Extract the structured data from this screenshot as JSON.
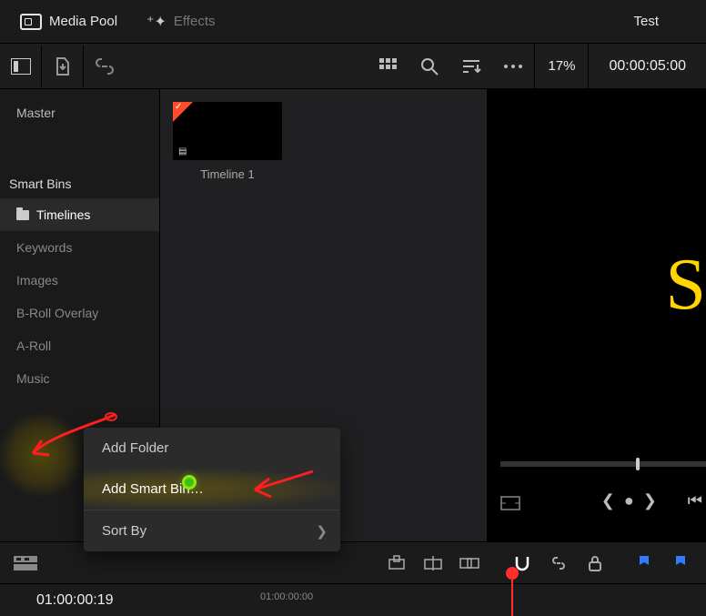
{
  "header": {
    "mediapool_label": "Media Pool",
    "effects_label": "Effects",
    "project_name": "Test"
  },
  "toolbar": {
    "zoom": "17%",
    "timecode": "00:00:05:00"
  },
  "sidebar": {
    "master_label": "Master",
    "smartbins_heading": "Smart Bins",
    "items": [
      {
        "label": "Timelines",
        "selected": true
      },
      {
        "label": "Keywords"
      },
      {
        "label": "Images"
      },
      {
        "label": "B-Roll Overlay"
      },
      {
        "label": "A-Roll"
      },
      {
        "label": "Music"
      }
    ]
  },
  "pool": {
    "clips": [
      {
        "label": "Timeline 1"
      }
    ]
  },
  "viewer": {
    "big_letter": "S"
  },
  "timeline": {
    "current_tc": "01:00:00:19",
    "ruler_start": "01:00:00:00"
  },
  "context_menu": {
    "items": [
      {
        "label": "Add Folder"
      },
      {
        "label": "Add Smart Bin…",
        "highlighted": true
      },
      {
        "label": "Sort By",
        "submenu": true
      }
    ]
  },
  "icons": {
    "slate": "▤"
  }
}
